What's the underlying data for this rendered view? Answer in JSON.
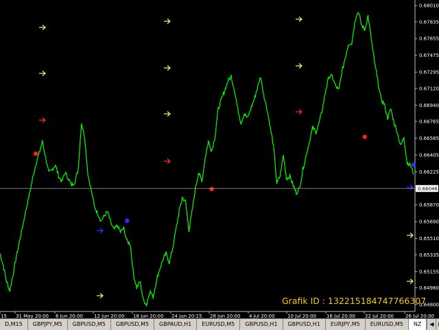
{
  "chart_data": {
    "type": "line",
    "series_color": "#00ff00",
    "y_ticks": [
      "0.68010",
      "0.67835",
      "0.67655",
      "0.67475",
      "0.67295",
      "0.67120",
      "0.66940",
      "0.66765",
      "0.66585",
      "0.66405",
      "0.66225",
      "0.65870",
      "0.65690",
      "0.65510",
      "0.65335",
      "0.65155",
      "0.64980",
      "0.64800"
    ],
    "ylim": [
      0.648,
      0.6801
    ],
    "x_ticks": [
      "15",
      "31 May 20:00",
      "6 Jun 20:00",
      "12 Jun 20:00",
      "18 Jun 20:00",
      "24 Jun 20:15",
      "28 Jun 20:00",
      "4 Jul 20:00",
      "10 Jul 20:00",
      "16 Jul 20:00",
      "22 Jul 20:00",
      "26 Jul 20:00"
    ],
    "current_price": "0.66046",
    "current_value": 0.66046,
    "series": [
      {
        "values": [
          0.6535,
          0.6522,
          0.6505,
          0.6495,
          0.6512,
          0.6531,
          0.6548,
          0.6565,
          0.6582,
          0.6598,
          0.6615,
          0.6631,
          0.6642,
          0.6655,
          0.6638,
          0.6621,
          0.6625,
          0.663,
          0.6618,
          0.6612,
          0.6622,
          0.6615,
          0.6608,
          0.6612,
          0.6625,
          0.6675,
          0.666,
          0.662,
          0.6603,
          0.6585,
          0.6578,
          0.657,
          0.6575,
          0.658,
          0.6568,
          0.656,
          0.6565,
          0.6558,
          0.6562,
          0.6548,
          0.6545,
          0.6512,
          0.6498,
          0.6505,
          0.6485,
          0.648,
          0.6495,
          0.6488,
          0.6505,
          0.6518,
          0.6528,
          0.6535,
          0.6525,
          0.654,
          0.656,
          0.658,
          0.6595,
          0.659,
          0.656,
          0.658,
          0.6605,
          0.6622,
          0.6612,
          0.6638,
          0.6655,
          0.6645,
          0.666,
          0.669,
          0.67,
          0.671,
          0.672,
          0.6725,
          0.671,
          0.669,
          0.6675,
          0.6685,
          0.668,
          0.669,
          0.67,
          0.6712,
          0.6725,
          0.6705,
          0.669,
          0.667,
          0.665,
          0.661,
          0.6618,
          0.664,
          0.6615,
          0.6618,
          0.6608,
          0.66,
          0.6605,
          0.6625,
          0.664,
          0.6655,
          0.667,
          0.6665,
          0.6675,
          0.669,
          0.671,
          0.6725,
          0.6725,
          0.6715,
          0.671,
          0.673,
          0.6745,
          0.676,
          0.676,
          0.6785,
          0.6795,
          0.678,
          0.6775,
          0.679,
          0.6765,
          0.674,
          0.672,
          0.67,
          0.6695,
          0.668,
          0.669,
          0.6675,
          0.6665,
          0.665,
          0.666,
          0.6632,
          0.663,
          0.662
        ]
      }
    ],
    "markers": [
      {
        "value": 0.6642,
        "index": 11,
        "color": "#ff2020"
      },
      {
        "value": 0.657,
        "index": 39,
        "color": "#3030ff"
      },
      {
        "value": 0.6604,
        "index": 65,
        "color": "#ff2020"
      },
      {
        "value": 0.666,
        "index": 112,
        "color": "#ff2020"
      },
      {
        "value": 0.663,
        "index": 127,
        "color": "#3030ff"
      }
    ],
    "signal_arrows": [
      {
        "color": "#f0f080"
      },
      {
        "color": "#f0f080"
      },
      {
        "color": "#ff3030"
      },
      {
        "color": "#3030ff"
      },
      {
        "color": "#f0f080"
      },
      {
        "color": "#f0f080"
      },
      {
        "color": "#f0f080"
      },
      {
        "color": "#f0f080"
      },
      {
        "color": "#ff3030"
      },
      {
        "color": "#f0f080"
      },
      {
        "color": "#f0f080"
      },
      {
        "color": "#ff3030"
      },
      {
        "color": "#f0f080"
      },
      {
        "color": "#f0f080"
      },
      {
        "color": "#3030ff"
      }
    ]
  },
  "watermark": "Grafik ID : 132215184747766307",
  "tabs": [
    "D,M15",
    "GBPJPY,M5",
    "GBPUSD,M5",
    "GBPUSD,M5",
    "GBPAUD,H1",
    "EURUSD,M5",
    "GBPUSD,H1",
    "GBPUSD,H1",
    "EURJPY,M5",
    "EURUSD,M5",
    "NZ"
  ],
  "active_tab_index": 10,
  "icons": {
    "prev": "triangle-left-icon",
    "next": "triangle-right-icon"
  }
}
